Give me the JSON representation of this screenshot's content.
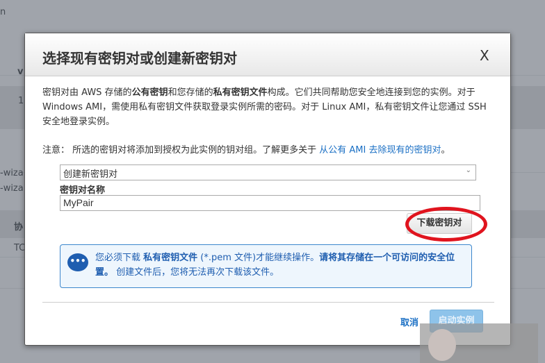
{
  "background": {
    "fragments": [
      "n",
      "v",
      "1",
      "-wiza",
      "-wiza",
      "协",
      "TC"
    ]
  },
  "dialog": {
    "title": "选择现有密钥对或创建新密钥对",
    "close_label": "X",
    "intro": {
      "p1": "密钥对由 AWS 存储的",
      "b1": "公有密钥",
      "p2": "和您存储的",
      "b2": "私有密钥文件",
      "p3": "构成。它们共同帮助您安全地连接到您的实例。对于 Windows AMI，需使用私有密钥文件获取登录实例所需的密码。对于 Linux AMI，私有密钥文件让您通过 SSH 安全地登录实例。"
    },
    "note": {
      "text": "注意： 所选的密钥对将添加到授权为此实例的钥对组。了解更多关于 ",
      "link": "从公有 AMI 去除现有的密钥对",
      "end": "。"
    },
    "select_value": "创建新密钥对",
    "name_label": "密钥对名称",
    "name_value": "MyPair",
    "download_button": "下载密钥对",
    "info": {
      "p1": "您必须下载 ",
      "b1": "私有密钥文件",
      "p2": " (*.pem 文件)才能继续操作。",
      "b2": "请将其存储在一个可访问的安全位置。",
      "p3": " 创建文件后，您将无法再次下载该文件。"
    },
    "cancel": "取消",
    "launch": "启动实例"
  },
  "colors": {
    "accent": "#1a6fc4",
    "highlight_ring": "#e0141e"
  }
}
